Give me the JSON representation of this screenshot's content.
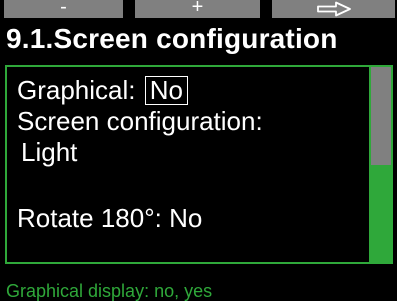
{
  "softkeys": {
    "minus": {
      "label": "-"
    },
    "plus": {
      "label": "+"
    },
    "next": {
      "icon": "arrow-right-icon"
    }
  },
  "header": {
    "title": "9.1.Screen configuration"
  },
  "content": {
    "graphical_label": "Graphical:",
    "graphical_value": "No",
    "screen_configuration_label": "Screen configuration:",
    "screen_configuration_value": "Light",
    "rotate_label": "Rotate 180°:",
    "rotate_value": "No"
  },
  "footer": {
    "hint": "Graphical display: no, yes"
  },
  "colors": {
    "accent": "#2fa83a",
    "softkey_bg": "#808080",
    "background": "#000000",
    "text": "#ffffff"
  }
}
